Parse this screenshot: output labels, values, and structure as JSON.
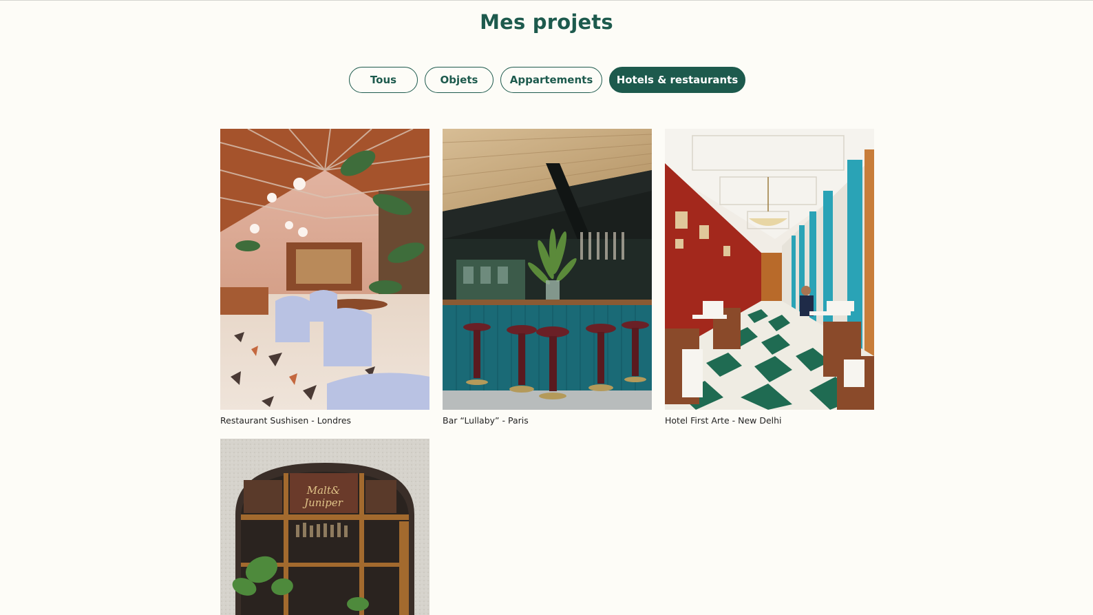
{
  "section": {
    "title": "Mes projets"
  },
  "filters": [
    {
      "label": "Tous",
      "active": false
    },
    {
      "label": "Objets",
      "active": false
    },
    {
      "label": "Appartements",
      "active": false
    },
    {
      "label": "Hotels & restaurants",
      "active": true
    }
  ],
  "projects": [
    {
      "caption": "Restaurant Sushisen - Londres"
    },
    {
      "caption": "Bar “Lullaby” - Paris"
    },
    {
      "caption": "Hotel First Arte - New Delhi"
    },
    {
      "caption": "",
      "sign_text": "Malt& Juniper"
    }
  ],
  "colors": {
    "accent": "#1d5a4d",
    "background": "#fdfcf7"
  }
}
